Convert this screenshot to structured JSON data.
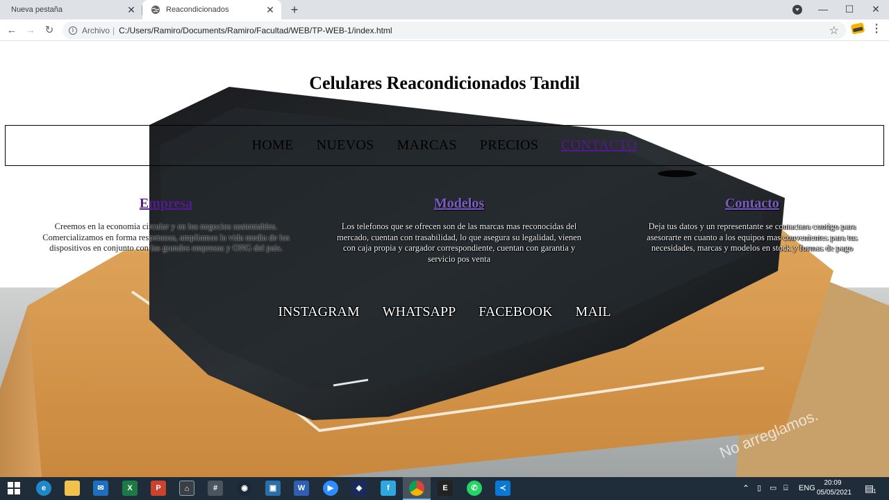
{
  "browser": {
    "tabs": [
      {
        "title": "Nueva pestaña",
        "active": false
      },
      {
        "title": "Reacondicionados",
        "active": true
      }
    ],
    "address": {
      "scheme_label": "Archivo",
      "url": "C:/Users/Ramiro/Documents/Ramiro/Facultad/WEB/TP-WEB-1/index.html"
    }
  },
  "page": {
    "title": "Celulares Reacondicionados Tandil",
    "nav": [
      {
        "label": "HOME",
        "visited": false
      },
      {
        "label": "NUEVOS",
        "visited": false
      },
      {
        "label": "MARCAS",
        "visited": false
      },
      {
        "label": "PRECIOS",
        "visited": false
      },
      {
        "label": "CONTACTO",
        "visited": true
      }
    ],
    "columns": [
      {
        "heading": "Empresa",
        "text": "Creemos en la economia circular y en los negocios sustentables. Comercializamos en forma respetuosa, ampliamos la vida media de los dispositivos en conjunto con las grandes empresas y ONG del pais."
      },
      {
        "heading": "Modelos",
        "text": "Los telefonos que se ofrecen son de las marcas mas reconocidas del mercado, cuentan con trasabilidad, lo que asegura su legalidad, vienen con caja propia y cargador correspondiente, cuentan con garantia y servicio pos venta"
      },
      {
        "heading": "Contacto",
        "text": "Deja tus datos y un representante se contactara contigo para asesorarte en cuanto a los equipos mas convenientes para tus necesidades, marcas y modelos en stock y formas de pago"
      }
    ],
    "social": [
      "INSTAGRAM",
      "WHATSAPP",
      "FACEBOOK",
      "MAIL"
    ]
  },
  "taskbar": {
    "language": "ENG",
    "time": "20:09",
    "date": "05/05/2021",
    "notification_count": "1"
  },
  "colors": {
    "visited_link": "#551a8b",
    "taskbar": "#1f2d3a",
    "tabbar": "#dee1e6"
  }
}
